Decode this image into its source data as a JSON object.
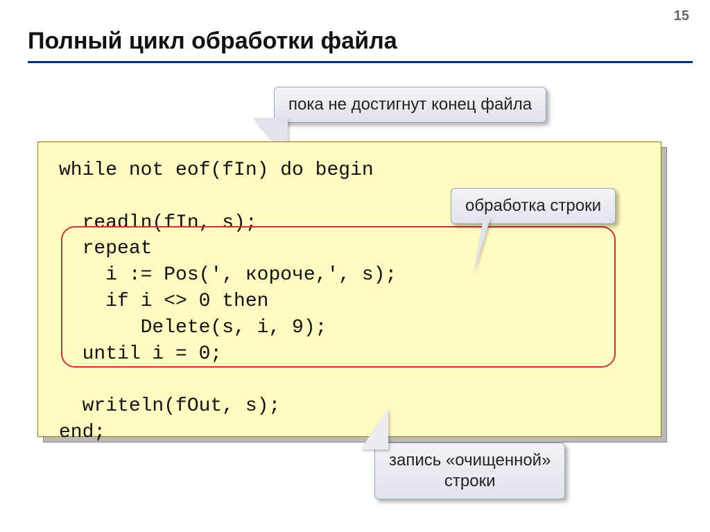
{
  "page_number": "15",
  "title": "Полный цикл обработки файла",
  "callouts": {
    "top": "пока не достигнут конец файла",
    "right": "обработка строки",
    "bottom": "запись «очищенной»\nстроки"
  },
  "code": {
    "line1": "while not eof(fIn) do begin",
    "line2": "  readln(fIn, s);",
    "line3": "  repeat",
    "line4": "    i := Pos(', короче,', s);",
    "line5": "    if i <> 0 then",
    "line6": "       Delete(s, i, 9);",
    "line7": "  until i = 0;",
    "line8": "  writeln(fOut, s);",
    "line9": "end;"
  }
}
